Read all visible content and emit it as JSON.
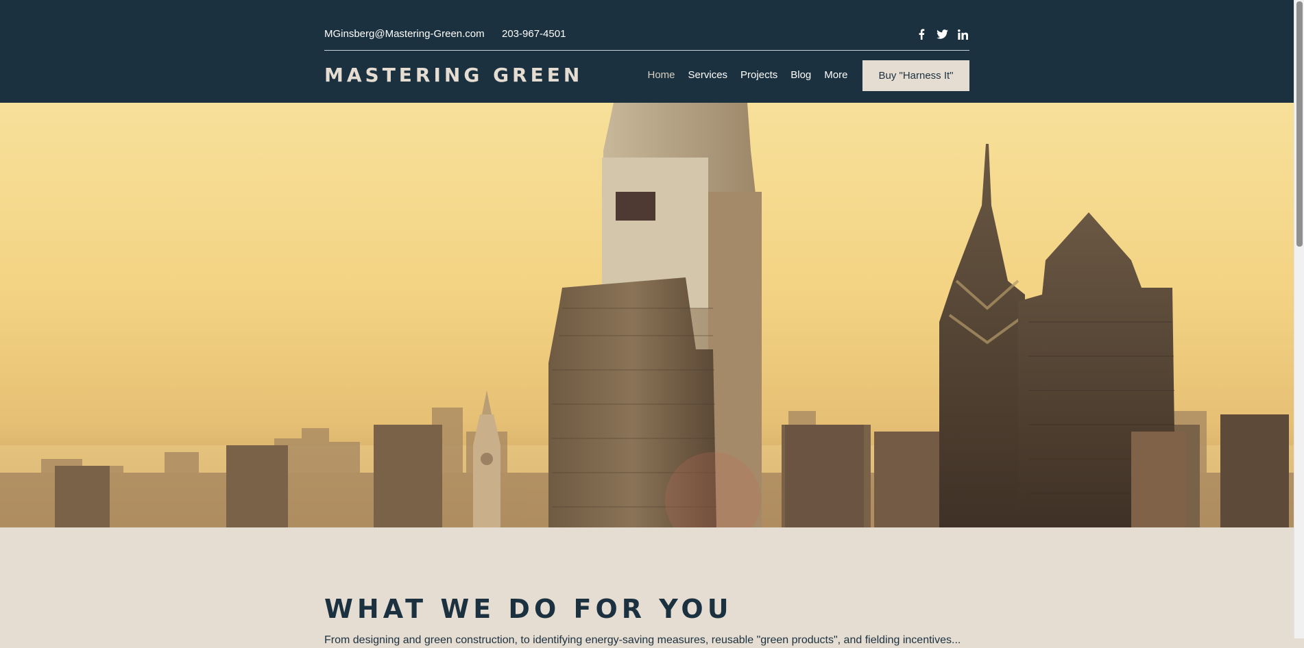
{
  "header": {
    "email": "MGinsberg@Mastering-Green.com",
    "phone": "203-967-4501",
    "social": [
      {
        "icon": "facebook-icon",
        "glyph": "f"
      },
      {
        "icon": "twitter-icon",
        "glyph": "t"
      },
      {
        "icon": "linkedin-icon",
        "glyph": "in"
      }
    ],
    "logo": "MASTERING GREEN",
    "nav": [
      "Home",
      "Services",
      "Projects",
      "Blog",
      "More"
    ],
    "buy_button": "Buy \"Harness It\""
  },
  "section": {
    "title": "WHAT WE DO FOR YOU",
    "text": "From designing and green construction, to identifying energy-saving measures, reusable \"green products\", and fielding incentives..."
  },
  "colors": {
    "header_bg": "#1b3140",
    "beige": "#e6ddd2",
    "text_dark": "#1b3140"
  }
}
